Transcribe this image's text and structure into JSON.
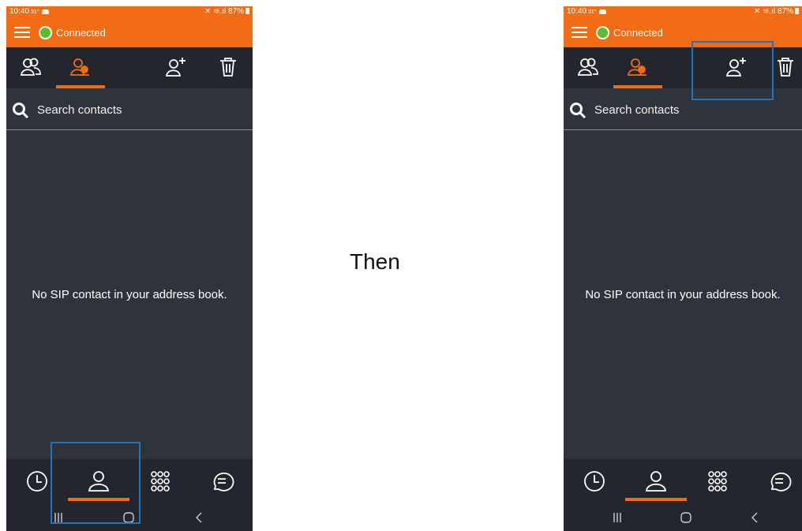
{
  "colors": {
    "accent": "#f26c16",
    "background": "#2f333c",
    "bar": "#23262d",
    "highlight": "#1f74c0",
    "online": "#55bf2d"
  },
  "separator": {
    "text": "Then"
  },
  "screens": [
    {
      "status": {
        "time": "10:40",
        "temp": "31°",
        "battery": "87%"
      },
      "header": {
        "connection": "Connected"
      },
      "tabs": [
        {
          "icon": "contacts-icon"
        },
        {
          "icon": "sip-contacts-icon",
          "active": true
        },
        {
          "icon": "add-contact-icon"
        },
        {
          "icon": "trash-icon"
        }
      ],
      "search": {
        "placeholder": "Search contacts"
      },
      "empty_message": "No SIP contact in your address book.",
      "bottom_nav": [
        {
          "icon": "history-icon"
        },
        {
          "icon": "contacts-icon",
          "active": true
        },
        {
          "icon": "dialpad-icon"
        },
        {
          "icon": "chat-icon"
        }
      ],
      "highlight": "contacts-nav-button"
    },
    {
      "status": {
        "time": "10:40",
        "temp": "31°",
        "battery": "87%"
      },
      "header": {
        "connection": "Connected"
      },
      "tabs": [
        {
          "icon": "contacts-icon"
        },
        {
          "icon": "sip-contacts-icon",
          "active": true
        },
        {
          "icon": "add-contact-icon"
        },
        {
          "icon": "trash-icon"
        }
      ],
      "search": {
        "placeholder": "Search contacts"
      },
      "empty_message": "No SIP contact in your address book.",
      "bottom_nav": [
        {
          "icon": "history-icon"
        },
        {
          "icon": "contacts-icon",
          "active": true
        },
        {
          "icon": "dialpad-icon"
        },
        {
          "icon": "chat-icon"
        }
      ],
      "highlight": "add-contact-button"
    }
  ]
}
